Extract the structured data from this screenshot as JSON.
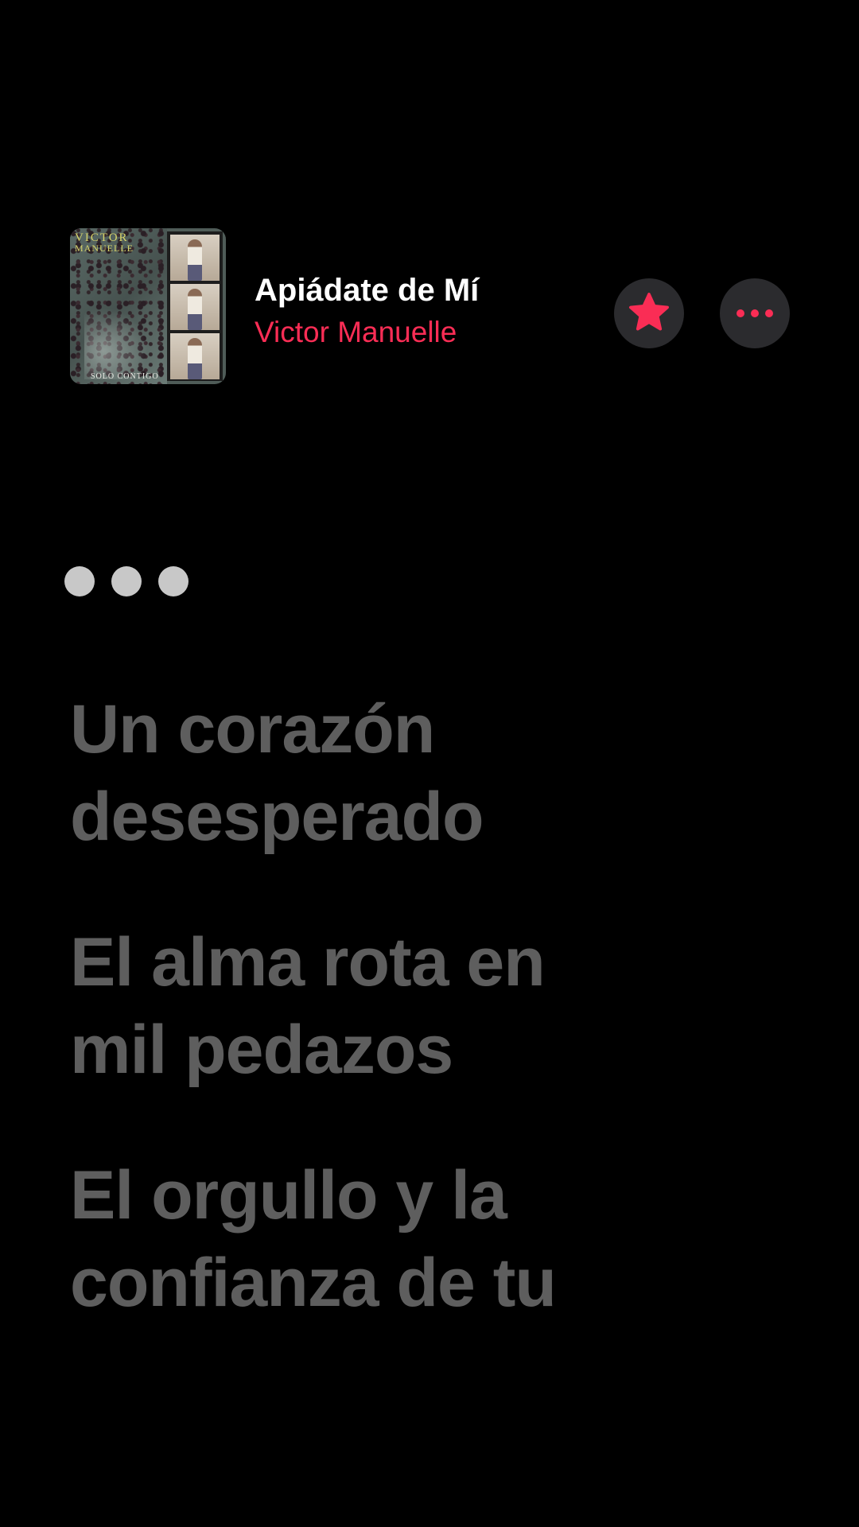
{
  "song": {
    "title": "Apiádate de Mí",
    "artist": "Victor Manuelle"
  },
  "artwork": {
    "title_line1": "VICTOR",
    "title_line2": "MANUELLE",
    "subtitle": "SOLO CONTIGO"
  },
  "actions": {
    "favorite_icon": "star-icon",
    "more_icon": "ellipsis-icon"
  },
  "lyrics": [
    "Un corazón\ndesesperado",
    "El alma rota en\nmil pedazos",
    "El orgullo y la\nconfianza de tu"
  ],
  "colors": {
    "background": "#000000",
    "accent": "#fa2d55",
    "lyric_inactive": "#5e5e5e",
    "button_bg": "#2b2b2e"
  }
}
